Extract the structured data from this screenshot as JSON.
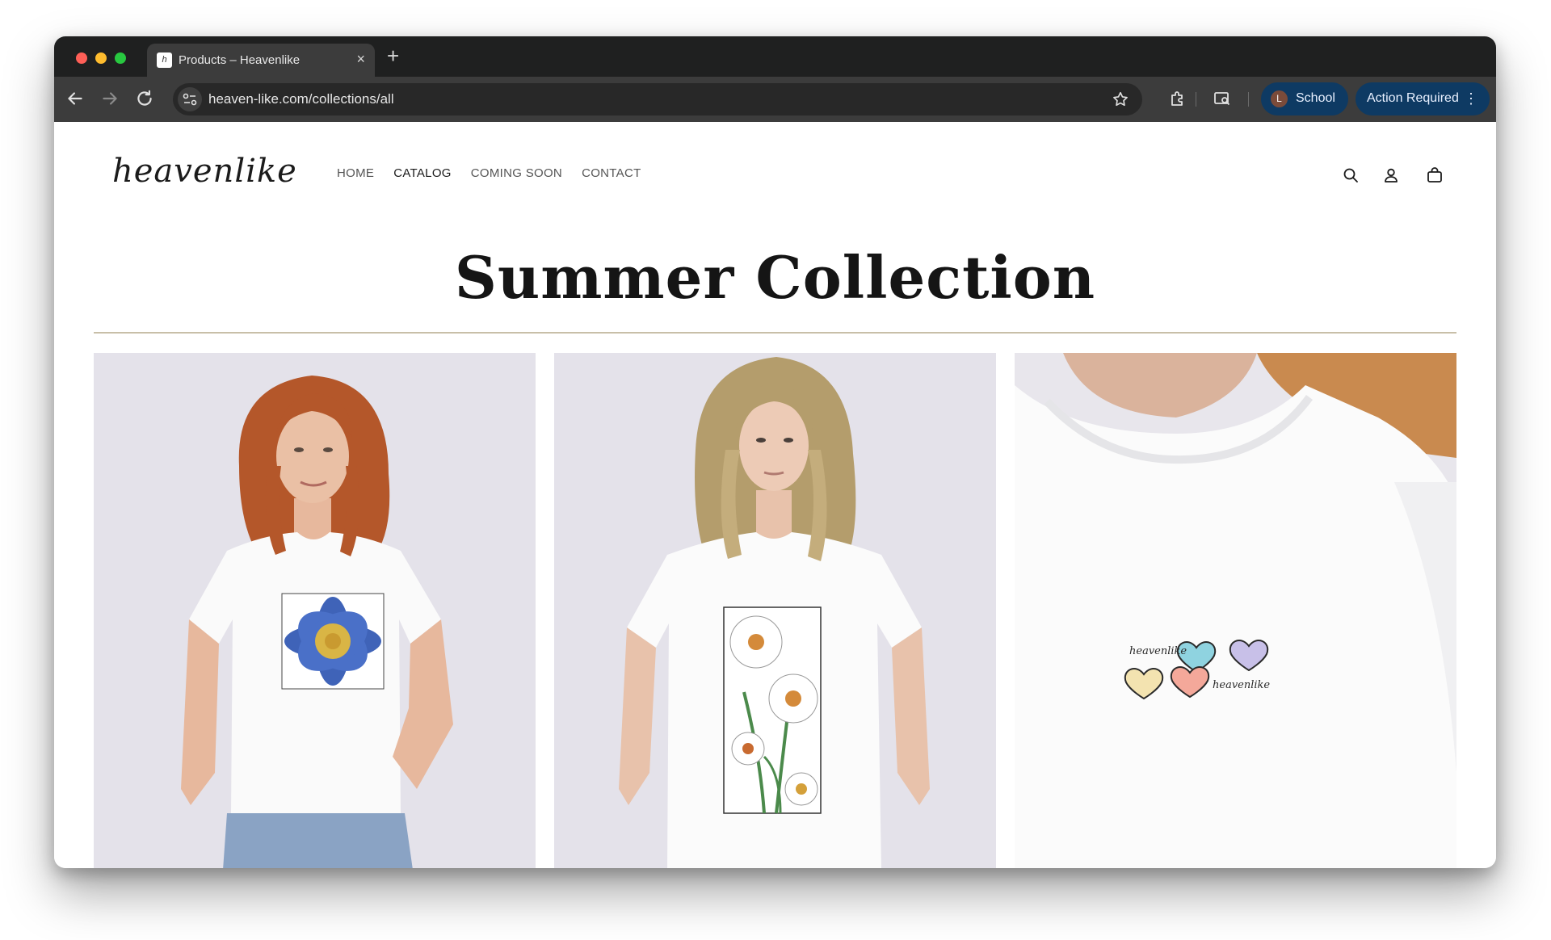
{
  "browser": {
    "tab_title": "Products – Heavenlike",
    "tab_close": "×",
    "new_tab": "+",
    "url": "heaven-like.com/collections/all",
    "profile": {
      "initial": "L",
      "label": "School"
    },
    "action_required": "Action Required",
    "action_menu": "⋮"
  },
  "site": {
    "logo": "heavenlike",
    "nav": [
      "HOME",
      "CATALOG",
      "COMING SOON",
      "CONTACT"
    ],
    "active_nav": "CATALOG"
  },
  "collection": {
    "title": "Summer Collection",
    "products": [
      {
        "print": "blue-flower-print",
        "hair": "#b4572a"
      },
      {
        "print": "daisy-print",
        "hair": "#b49d6c"
      },
      {
        "print": "hearts-print",
        "brand_marks": [
          "heavenlike",
          "heavenlike"
        ]
      }
    ]
  },
  "colors": {
    "chrome_dark": "#1f2020",
    "toolbar": "#3c3c3c",
    "profile_chip": "#0e3a63",
    "divider": "#c8bfa8",
    "photo_bg": "#e4e2ea"
  }
}
